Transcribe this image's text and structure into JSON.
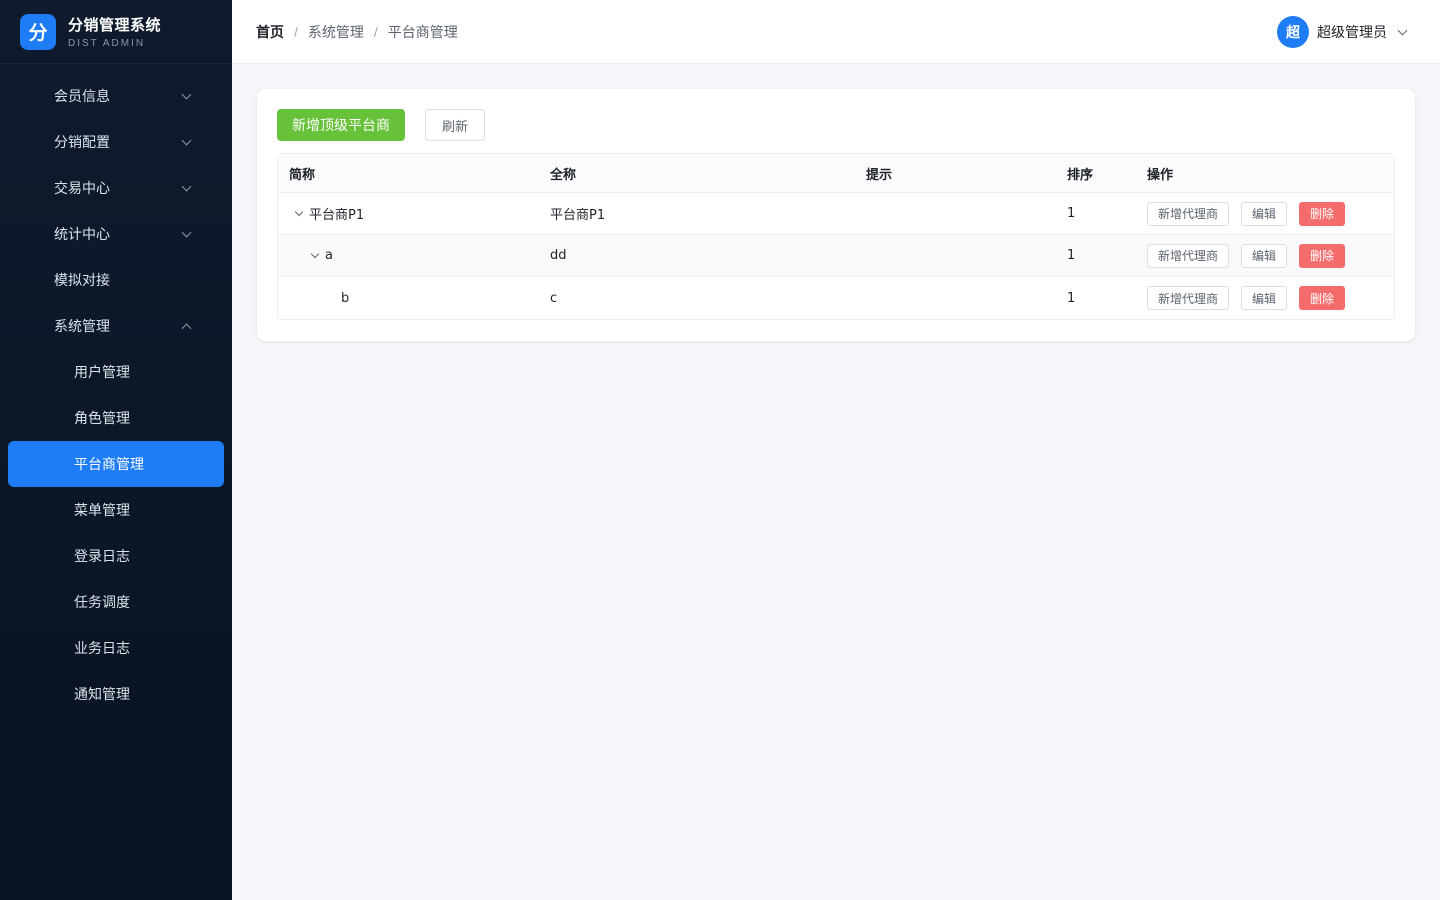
{
  "brand": {
    "logo_char": "分",
    "title": "分销管理系统",
    "subtitle": "DIST ADMIN"
  },
  "sidebar": {
    "items": [
      {
        "label": "会员信息"
      },
      {
        "label": "分销配置"
      },
      {
        "label": "交易中心"
      },
      {
        "label": "统计中心"
      },
      {
        "label": "模拟对接"
      },
      {
        "label": "系统管理"
      }
    ],
    "sub_items": [
      {
        "label": "用户管理"
      },
      {
        "label": "角色管理"
      },
      {
        "label": "平台商管理"
      },
      {
        "label": "菜单管理"
      },
      {
        "label": "登录日志"
      },
      {
        "label": "任务调度"
      },
      {
        "label": "业务日志"
      },
      {
        "label": "通知管理"
      }
    ]
  },
  "breadcrumb": [
    "首页",
    "系统管理",
    "平台商管理"
  ],
  "breadcrumb_sep": "/",
  "user": {
    "avatar_char": "超",
    "name": "超级管理员"
  },
  "toolbar": {
    "add_label": "新增顶级平台商",
    "refresh_label": "刷新"
  },
  "table": {
    "headers": [
      "简称",
      "全称",
      "提示",
      "排序",
      "操作"
    ],
    "rows": [
      {
        "short": "平台商P1",
        "full": "平台商P1",
        "hint": "",
        "sort": "1"
      },
      {
        "short": "a",
        "full": "dd",
        "hint": "",
        "sort": "1"
      },
      {
        "short": "b",
        "full": "c",
        "hint": "",
        "sort": "1"
      }
    ],
    "actions": {
      "add_agent": "新增代理商",
      "edit": "编辑",
      "delete": "删除"
    }
  },
  "colors": {
    "accent": "#1e7cf6",
    "success": "#67c23a",
    "danger": "#f56c6c",
    "sidebar_bg": "#0f1b2d"
  }
}
